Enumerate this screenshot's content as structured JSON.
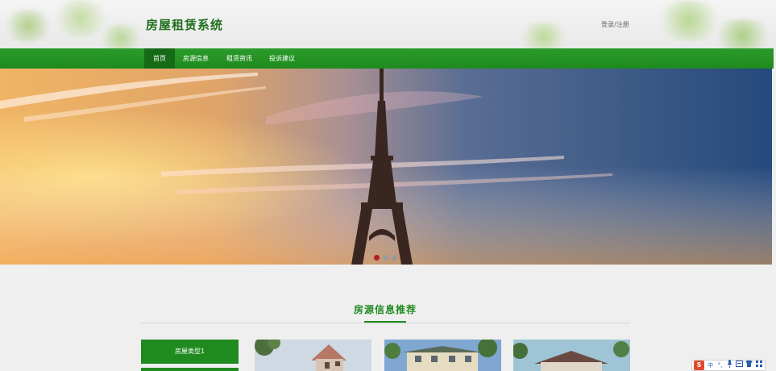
{
  "header": {
    "site_title": "房屋租赁系统",
    "login_link": "登录/注册"
  },
  "nav": {
    "items": [
      {
        "label": "首页",
        "active": true
      },
      {
        "label": "房源信息",
        "active": false
      },
      {
        "label": "租赁资讯",
        "active": false
      },
      {
        "label": "投诉建议",
        "active": false
      }
    ]
  },
  "banner": {
    "slide_count": 3,
    "active_slide": 1
  },
  "recommend": {
    "title": "房源信息推荐",
    "categories": [
      "房屋类型1",
      ""
    ]
  },
  "ime_toolbar": {
    "logo": "S",
    "items": [
      "中",
      "°,",
      "mic-icon",
      "keyboard-icon",
      "shirt-icon",
      "grid-icon"
    ],
    "chinese_mode": "中",
    "punct_mode": "°,"
  },
  "colors": {
    "primary_green": "#1f8a1f",
    "nav_active": "#156b15",
    "title_green": "#1f6f1f"
  }
}
